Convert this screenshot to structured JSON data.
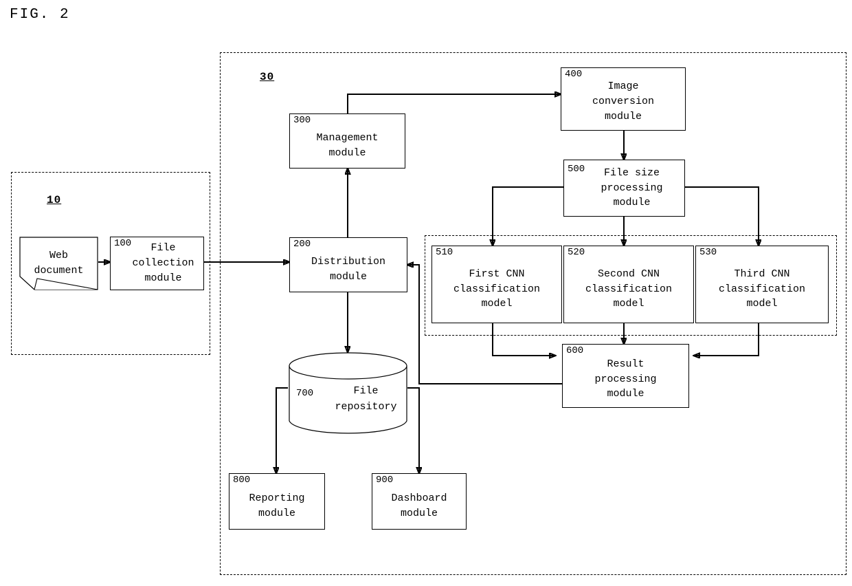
{
  "figure": {
    "title": "FIG. 2"
  },
  "groups": [
    {
      "id": "group-10",
      "label": "10"
    },
    {
      "id": "group-30",
      "label": "30"
    }
  ],
  "modules": [
    {
      "id": "web-document",
      "ref": "",
      "label": "Web\ndocument"
    },
    {
      "id": "file-collection",
      "ref": "100",
      "label": "File\ncollection\nmodule"
    },
    {
      "id": "management",
      "ref": "300",
      "label": "Management\nmodule"
    },
    {
      "id": "image-conversion",
      "ref": "400",
      "label": "Image\nconversion\nmodule"
    },
    {
      "id": "file-size",
      "ref": "500",
      "label": "File size\nprocessing\nmodule"
    },
    {
      "id": "distribution",
      "ref": "200",
      "label": "Distribution\nmodule"
    },
    {
      "id": "first-cnn",
      "ref": "510",
      "label": "First CNN\nclassification\nmodel"
    },
    {
      "id": "second-cnn",
      "ref": "520",
      "label": "Second CNN\nclassification\nmodel"
    },
    {
      "id": "third-cnn",
      "ref": "530",
      "label": "Third CNN\nclassification\nmodel"
    },
    {
      "id": "result-processing",
      "ref": "600",
      "label": "Result\nprocessing\nmodule"
    },
    {
      "id": "file-repository",
      "ref": "700",
      "label": "File\nrepository"
    },
    {
      "id": "reporting",
      "ref": "800",
      "label": "Reporting\nmodule"
    },
    {
      "id": "dashboard",
      "ref": "900",
      "label": "Dashboard\nmodule"
    }
  ],
  "labels": {
    "web_document": "Web\ndocument",
    "file_collection_ref": "100",
    "file_collection": "File\ncollection\nmodule",
    "management_ref": "300",
    "management": "Management\nmodule",
    "image_conversion_ref": "400",
    "image_conversion": "Image\nconversion\nmodule",
    "file_size_ref": "500",
    "file_size": "File size\nprocessing\nmodule",
    "distribution_ref": "200",
    "distribution": "Distribution\nmodule",
    "first_cnn_ref": "510",
    "first_cnn": "First CNN\nclassification\nmodel",
    "second_cnn_ref": "520",
    "second_cnn": "Second CNN\nclassification\nmodel",
    "third_cnn_ref": "530",
    "third_cnn": "Third CNN\nclassification\nmodel",
    "result_ref": "600",
    "result": "Result\nprocessing\nmodule",
    "repository_ref": "700",
    "repository": "File\nrepository",
    "reporting_ref": "800",
    "reporting": "Reporting\nmodule",
    "dashboard_ref": "900",
    "dashboard": "Dashboard\nmodule",
    "group_10": "10",
    "group_30": "30"
  },
  "colors": {
    "line": "#000000",
    "background": "#ffffff"
  }
}
